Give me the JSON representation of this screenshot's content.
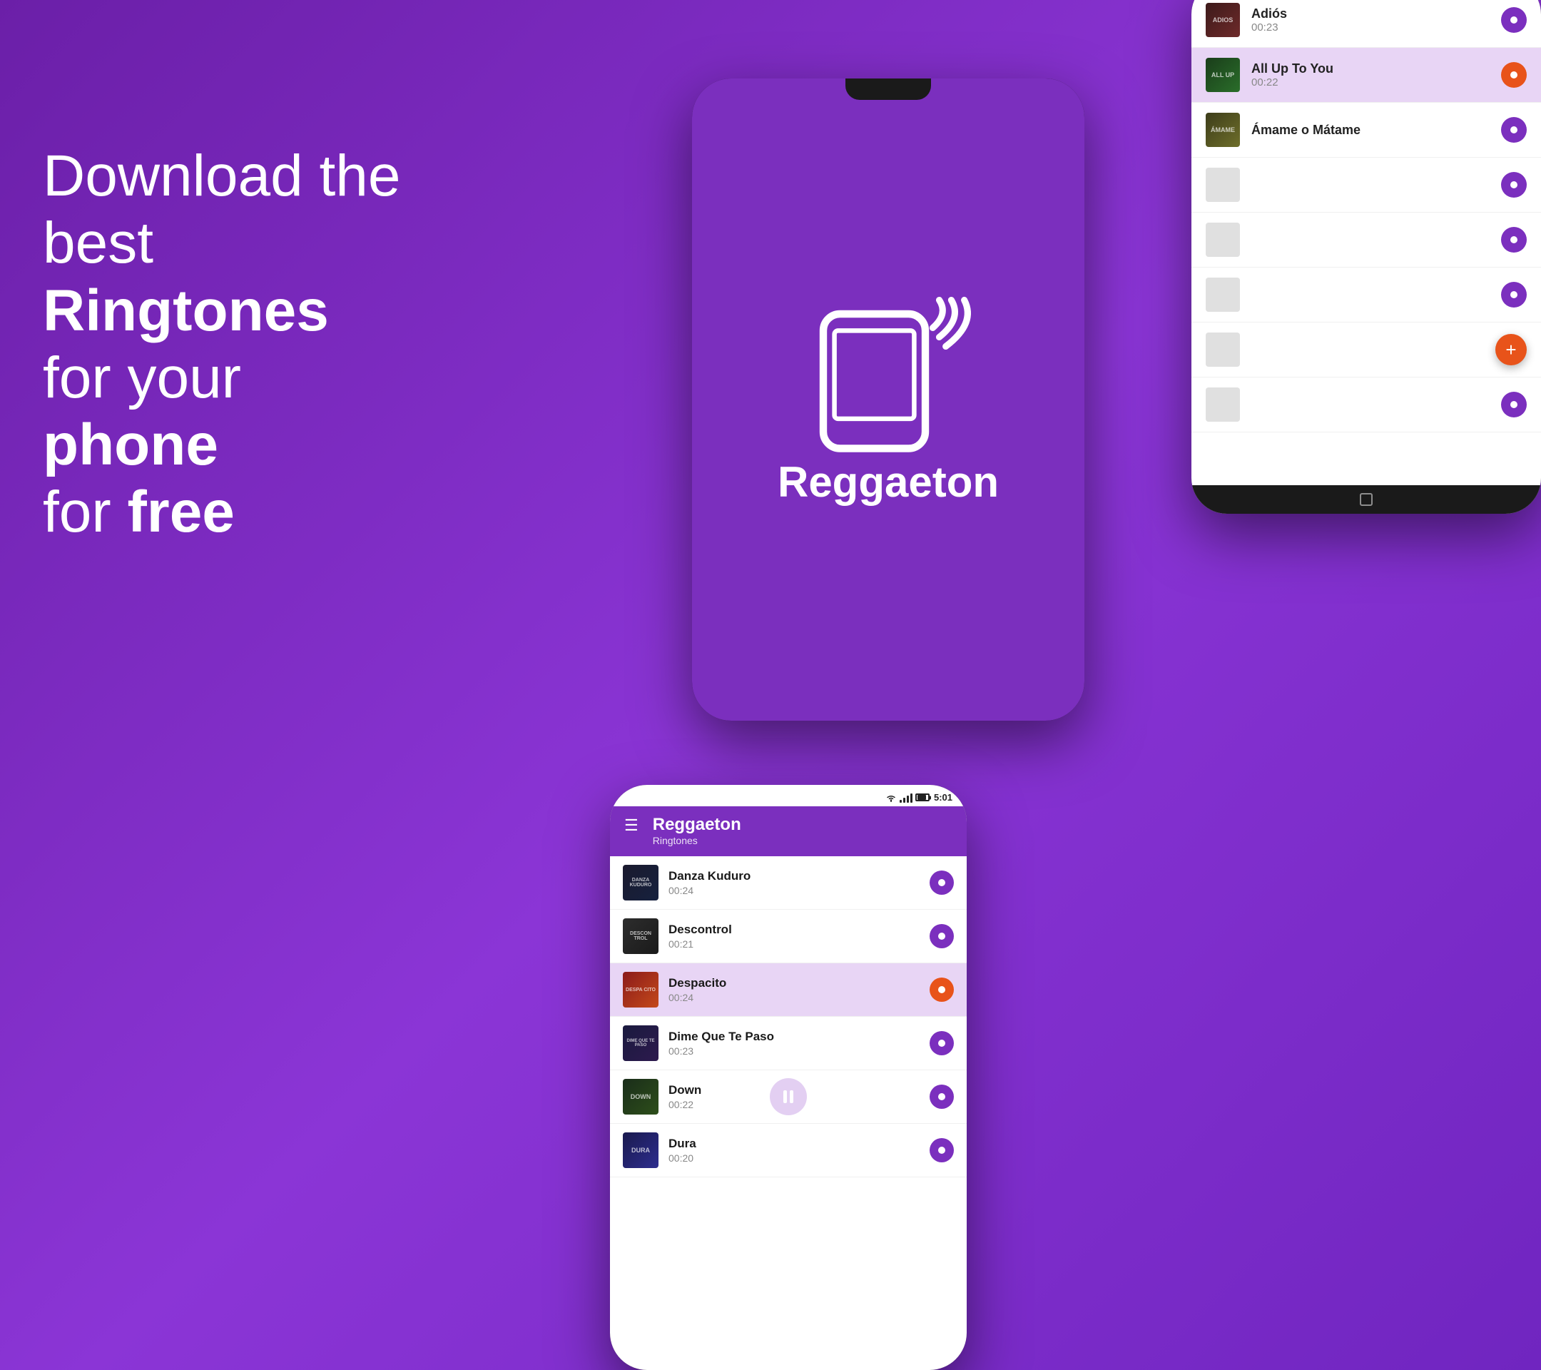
{
  "background": {
    "color": "#7B2FBE"
  },
  "hero": {
    "line1": "Download the",
    "line2": "best Ringtones",
    "line3": "for your phone",
    "line4": "for free"
  },
  "center_phone": {
    "app_name": "Reggaeton",
    "screen_color": "#7B2FBE"
  },
  "back_phone": {
    "songs": [
      {
        "title": "Adiós",
        "duration": "00:23",
        "thumb_class": "thumb-adios",
        "thumb_label": "ADIOS",
        "active": false,
        "button": "purple"
      },
      {
        "title": "All Up To You",
        "duration": "00:22",
        "thumb_class": "thumb-allupto",
        "thumb_label": "ALL UP",
        "active": true,
        "button": "orange"
      },
      {
        "title": "Ámame o Mátame",
        "duration": "",
        "thumb_class": "thumb-amate",
        "thumb_label": "ÁMAME",
        "active": false,
        "button": "purple"
      }
    ],
    "extra_dots": 6,
    "fab_label": "+"
  },
  "front_phone": {
    "status_time": "5:01",
    "header_title": "Reggaeton",
    "header_subtitle": "Ringtones",
    "songs": [
      {
        "title": "Danza Kuduro",
        "duration": "00:24",
        "thumb_class": "thumb-danza",
        "thumb_label": "DANZA\nKUDURO",
        "active": false,
        "button": "purple",
        "playing": false
      },
      {
        "title": "Descontrol",
        "duration": "00:21",
        "thumb_class": "thumb-descontrol",
        "thumb_label": "DESCON\nTROL",
        "active": false,
        "button": "purple",
        "playing": false
      },
      {
        "title": "Despacito",
        "duration": "00:24",
        "thumb_class": "thumb-despacito",
        "thumb_label": "DESPA\nCITO",
        "active": true,
        "button": "orange",
        "playing": false
      },
      {
        "title": "Dime Que Te Paso",
        "duration": "00:23",
        "thumb_class": "thumb-dime",
        "thumb_label": "DIME Q\nTE PASO",
        "active": false,
        "button": "purple",
        "playing": false
      },
      {
        "title": "Down",
        "duration": "00:22",
        "thumb_class": "thumb-down",
        "thumb_label": "DOWN",
        "active": false,
        "button": "purple",
        "playing": true
      },
      {
        "title": "Dura",
        "duration": "00:20",
        "thumb_class": "thumb-dura",
        "thumb_label": "DURA",
        "active": false,
        "button": "purple",
        "playing": false
      }
    ]
  }
}
